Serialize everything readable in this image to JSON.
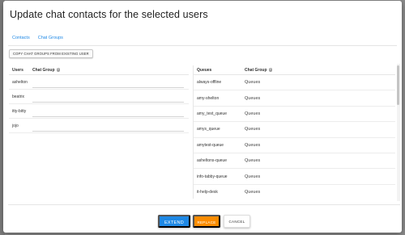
{
  "modal": {
    "title": "Update chat contacts for the selected users"
  },
  "tabs": [
    {
      "label": "Contacts",
      "active": false
    },
    {
      "label": "Chat Groups",
      "active": true
    }
  ],
  "copy_button_label": "COPY CHAT GROUPS FROM EXISTING USER",
  "users_table": {
    "headers": {
      "users": "Users",
      "chat_group": "Chat Group"
    },
    "rows": [
      "ashelton",
      "beatrix",
      "itty-bitty",
      "jojo"
    ]
  },
  "queues_table": {
    "headers": {
      "queues": "Queues",
      "chat_group": "Chat Group"
    },
    "rows": [
      {
        "queue": "always-offline",
        "group": "Queues"
      },
      {
        "queue": "amy-shelton",
        "group": "Queues"
      },
      {
        "queue": "amy_test_queue",
        "group": "Queues"
      },
      {
        "queue": "amys_queue",
        "group": "Queues"
      },
      {
        "queue": "amytest-queue",
        "group": "Queues"
      },
      {
        "queue": "asheltons-queue",
        "group": "Queues"
      },
      {
        "queue": "info-tabby-queue",
        "group": "Queues"
      },
      {
        "queue": "it-help-desk",
        "group": "Queues"
      }
    ]
  },
  "footer": {
    "extend_label": "EXTEND",
    "replace_label": "REPLACE",
    "cancel_label": "CANCEL"
  },
  "colors": {
    "primary": "#1e88e5",
    "replace": "#fb8c00",
    "backdrop": "#8a8a8a"
  },
  "icons": {
    "help": "help-circle-icon"
  }
}
